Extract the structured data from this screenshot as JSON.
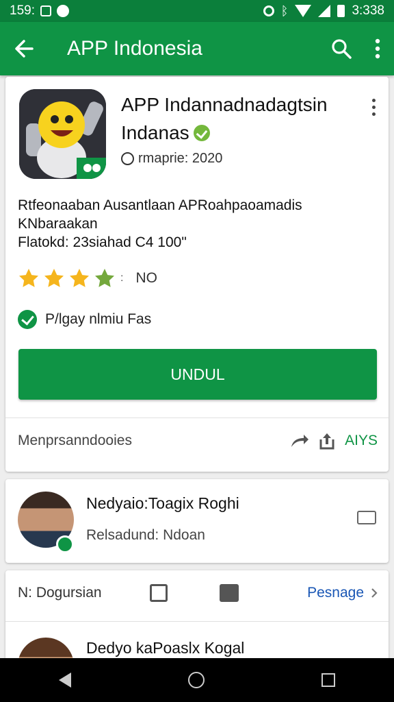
{
  "status_bar": {
    "time_left": "159:",
    "time_right": "3:338"
  },
  "app_bar": {
    "title": "APP Indonesia"
  },
  "app_detail": {
    "title_line1": "APP Indannadnadagtsin",
    "title_line2": "Indanas",
    "publisher": "rmaprie: 2020",
    "description": "Rtfeonaaban Ausantlaan APRoahpaoamadis KNbaraakan",
    "platform": "Flatokd: 23siahad C4 100\"",
    "rating_stars": 4,
    "rating_separator": ":",
    "rating_value": "NO",
    "feature": "P/lgay nlmiu Fas",
    "install_label": "UNDUL",
    "share_label": "Menprsanndooies",
    "share_action": "AIYS"
  },
  "developer": {
    "name": "Nedyaio:Toagix Roghi",
    "subtitle": "Relsadund: Ndoan"
  },
  "reviews": {
    "label": "N: Dogursian",
    "link": "Pesnage",
    "next_name": "Dedyo kaPoaslx Kogal"
  },
  "colors": {
    "primary": "#0f9445",
    "status_bar": "#0b7f3b",
    "star": "#f5b51d",
    "star_partial": "#74a83c",
    "link": "#1a57b5"
  },
  "icons": [
    "back-arrow-icon",
    "search-icon",
    "overflow-menu-icon",
    "verified-icon",
    "star-icon",
    "check-circle-icon",
    "share-icon",
    "upload-icon",
    "chat-icon",
    "thumbs-up-icon",
    "chevron-right-icon"
  ]
}
